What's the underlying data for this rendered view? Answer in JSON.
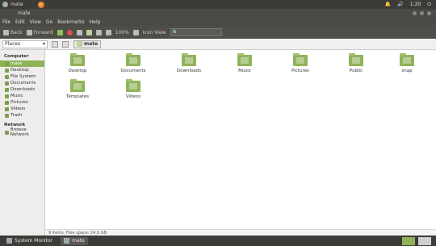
{
  "top_panel": {
    "app_name": "mate",
    "tray": [
      "🔔",
      "🔊",
      "1:20",
      "⏻"
    ]
  },
  "window": {
    "title": "mate",
    "controls": [
      "minimize",
      "maximize",
      "close"
    ]
  },
  "menu": {
    "items": [
      "File",
      "Edit",
      "View",
      "Go",
      "Bookmarks",
      "Help"
    ]
  },
  "toolbar": {
    "back": "Back",
    "forward": "Forward",
    "zoom": "100%",
    "view": "Icon View",
    "search_placeholder": ""
  },
  "pathbar": {
    "places_label": "Places",
    "current_folder": "mate"
  },
  "sidebar": {
    "computer_heading": "Computer",
    "network_heading": "Network",
    "items": [
      "mate",
      "Desktop",
      "File System",
      "Documents",
      "Downloads",
      "Music",
      "Pictures",
      "Videos",
      "Trash"
    ],
    "network_items": [
      "Browse Network"
    ]
  },
  "files": [
    "Desktop",
    "Documents",
    "Downloads",
    "Music",
    "Pictures",
    "Public",
    "snap",
    "Templates",
    "Videos"
  ],
  "status": "9 items, Free space: 24,9 GB",
  "taskbar": {
    "items": [
      "System Monitor",
      "mate"
    ]
  }
}
